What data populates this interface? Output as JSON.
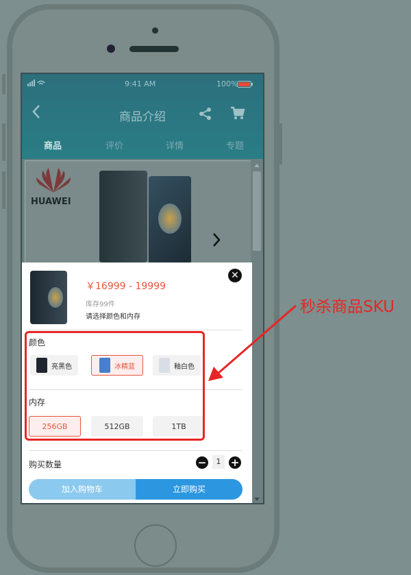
{
  "status_bar": {
    "time": "9:41 AM",
    "battery": "100%"
  },
  "nav": {
    "title": "商品介绍",
    "back_icon": "chevron-left-icon",
    "share_icon": "share-icon",
    "cart_icon": "cart-icon"
  },
  "tabs": [
    {
      "label": "商品",
      "active": true
    },
    {
      "label": "评价",
      "active": false
    },
    {
      "label": "详情",
      "active": false
    },
    {
      "label": "专题",
      "active": false
    }
  ],
  "banner": {
    "brand": "HUAWEI"
  },
  "sku_sheet": {
    "price": "￥16999 - 19999",
    "stock": "库存99件",
    "hint": "请选择颜色和内存",
    "color_label": "颜色",
    "colors": [
      {
        "label": "亮黑色",
        "selected": false,
        "thumb_color": "#1f2530"
      },
      {
        "label": "冰精蓝",
        "selected": true,
        "thumb_color": "#4a7ec9"
      },
      {
        "label": "釉白色",
        "selected": false,
        "thumb_color": "#e8ecf2"
      }
    ],
    "memory_label": "内存",
    "memories": [
      {
        "label": "256GB",
        "selected": true
      },
      {
        "label": "512GB",
        "selected": false
      },
      {
        "label": "1TB",
        "selected": false
      }
    ],
    "quantity_label": "购买数量",
    "quantity": "1",
    "add_to_cart": "加入购物车",
    "buy_now": "立即购买"
  },
  "annotation": {
    "text": "秒杀商品SKU"
  },
  "colors": {
    "accent": "#e8533b",
    "annotation": "#e82525",
    "buy": "#2c97e0",
    "cart": "#8cc9ef"
  }
}
